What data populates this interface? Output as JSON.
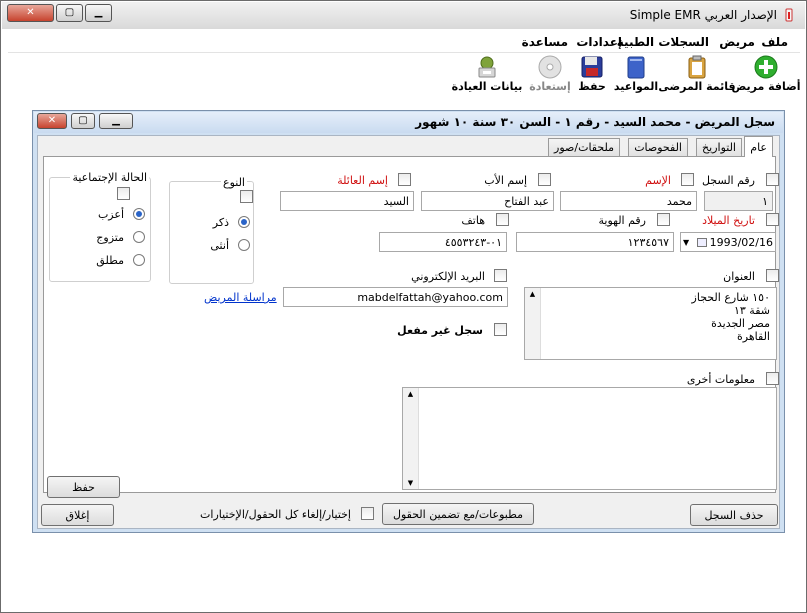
{
  "app": {
    "title": "Simple EMR الإصدار العربي"
  },
  "menu": [
    "ملف",
    "مريض",
    "السجلات الطبية",
    "إعدادات",
    "مساعدة"
  ],
  "toolbar": {
    "add_patient": "أضافة مريض",
    "patient_list": "قائمة المرضى",
    "appointments": "المواعيد",
    "save": "حفظ",
    "restore": "إستعادة",
    "clinic_data": "بيانات العيادة"
  },
  "record": {
    "title": "سجل المريض - محمد السيد - رقم ١ - السن ٣٠ سنة ١٠ شهور",
    "tabs": [
      "عام",
      "التواريخ",
      "الفحوصات",
      "ملحقات/صور"
    ]
  },
  "fields": {
    "record_no_label": "رقم السجل",
    "record_no_value": "١",
    "first_name_label": "الإسم",
    "first_name_value": "محمد",
    "father_name_label": "إسم الأب",
    "father_name_value": "عبد الفتاح",
    "family_name_label": "إسم العائلة",
    "family_name_value": "السيد",
    "dob_label": "تاريخ الميلاد",
    "dob_value": "1993/02/16",
    "id_no_label": "رقم الهوية",
    "id_no_value": "١٢٣٤٥٦٧",
    "phone_label": "هاتف",
    "phone_value": "٠١-٤٥٥٣٢٤٣",
    "address_label": "العنوان",
    "address_lines": [
      "١٥٠ شارع الحجاز",
      "شقة ١٣",
      "مصر الجديدة",
      "القاهرة"
    ],
    "email_label": "البريد الإلكتروني",
    "email_value": "mabdelfattah@yahoo.com",
    "contact_link": "مراسلة المريض",
    "inactive_label": "سجل غير مفعل",
    "other_info_label": "معلومات أخرى"
  },
  "gender": {
    "title": "النوع",
    "options": [
      "ذكر",
      "أنثى"
    ],
    "selected": "ذكر"
  },
  "marital": {
    "title": "الحالة الإجتماعية",
    "options": [
      "أعزب",
      "متزوج",
      "مطلق"
    ],
    "selected": "أعزب"
  },
  "buttons": {
    "save_small": "حفظ",
    "delete_record": "حذف السجل",
    "print_with_fields": "مطبوعات/مع تضمين الحقول",
    "select_all_label": "إختيار/إلغاء كل الحقول/الإختيارات",
    "close": "إغلاق"
  },
  "colors": {
    "accent": "#2a64c8",
    "required_label": "#d01010",
    "inner_frame": "#cfe0f2"
  }
}
